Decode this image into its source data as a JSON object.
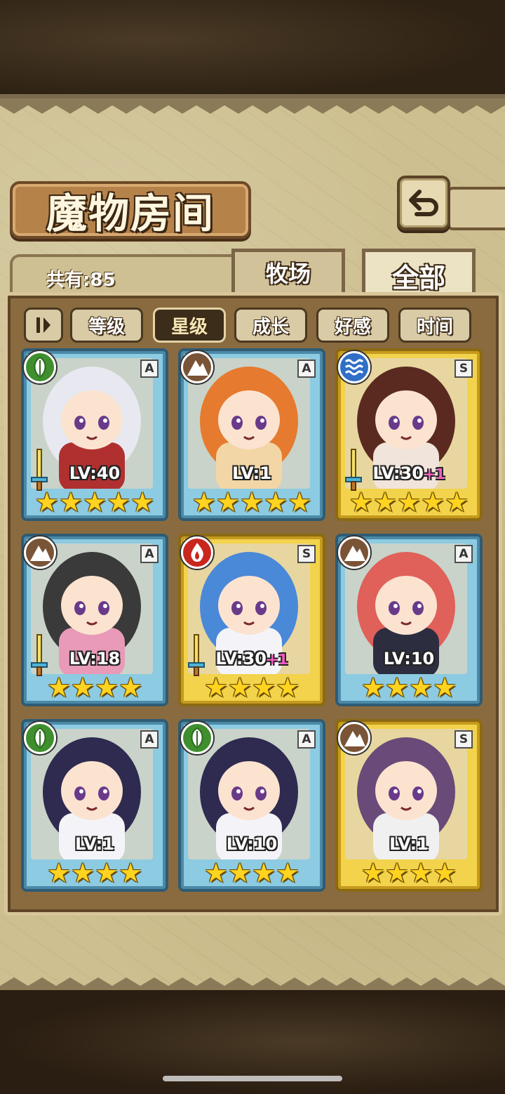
{
  "header": {
    "title": "魔物房间",
    "count_label": "共有:85"
  },
  "tabs": [
    {
      "label": "牧场",
      "active": false
    },
    {
      "label": "全部",
      "active": true
    }
  ],
  "sort": {
    "buttons": [
      {
        "label": "等级",
        "active": false
      },
      {
        "label": "星级",
        "active": true
      },
      {
        "label": "成长",
        "active": false
      },
      {
        "label": "好感",
        "active": false
      },
      {
        "label": "时间",
        "active": false
      }
    ]
  },
  "monsters": [
    {
      "rank": "A",
      "element": "leaf-icon",
      "level": "LV:40",
      "bonus": "",
      "stars": 5,
      "weapon": true,
      "frame": "a",
      "palette": [
        "#e8e8f0",
        "#b03030"
      ]
    },
    {
      "rank": "A",
      "element": "mountain-icon",
      "level": "LV:1",
      "bonus": "",
      "stars": 5,
      "weapon": false,
      "frame": "a",
      "palette": [
        "#e67a2e",
        "#f3d6a6"
      ]
    },
    {
      "rank": "S",
      "element": "water-icon",
      "level": "LV:30",
      "bonus": "+1",
      "stars": 5,
      "weapon": true,
      "frame": "s",
      "palette": [
        "#5a2a20",
        "#f1e4da"
      ]
    },
    {
      "rank": "A",
      "element": "mountain-icon",
      "level": "LV:18",
      "bonus": "",
      "stars": 4,
      "weapon": true,
      "frame": "a",
      "palette": [
        "#3a3a3a",
        "#e89ab8"
      ]
    },
    {
      "rank": "S",
      "element": "fire-icon",
      "level": "LV:30",
      "bonus": "+1",
      "stars": 4,
      "weapon": true,
      "frame": "s",
      "palette": [
        "#4a88d8",
        "#f4f4f8"
      ]
    },
    {
      "rank": "A",
      "element": "mountain-icon",
      "level": "LV:10",
      "bonus": "",
      "stars": 4,
      "weapon": false,
      "frame": "a",
      "palette": [
        "#e0605a",
        "#2d2d40"
      ]
    },
    {
      "rank": "A",
      "element": "leaf-icon",
      "level": "LV:1",
      "bonus": "",
      "stars": 4,
      "weapon": false,
      "frame": "a",
      "palette": [
        "#2e2a50",
        "#f4f4f8"
      ]
    },
    {
      "rank": "A",
      "element": "leaf-icon",
      "level": "LV:10",
      "bonus": "",
      "stars": 4,
      "weapon": false,
      "frame": "a",
      "palette": [
        "#2e2a50",
        "#f4f4f8"
      ]
    },
    {
      "rank": "S",
      "element": "mountain-icon",
      "level": "LV:1",
      "bonus": "",
      "stars": 4,
      "weapon": false,
      "frame": "s",
      "palette": [
        "#6a4a78",
        "#f0f0f0"
      ]
    }
  ],
  "colors": {
    "leaf": "#3f8f2e",
    "mountain": "#7a5436",
    "water": "#2f6fc7",
    "fire": "#c8261e",
    "star": "#ffd31f"
  }
}
